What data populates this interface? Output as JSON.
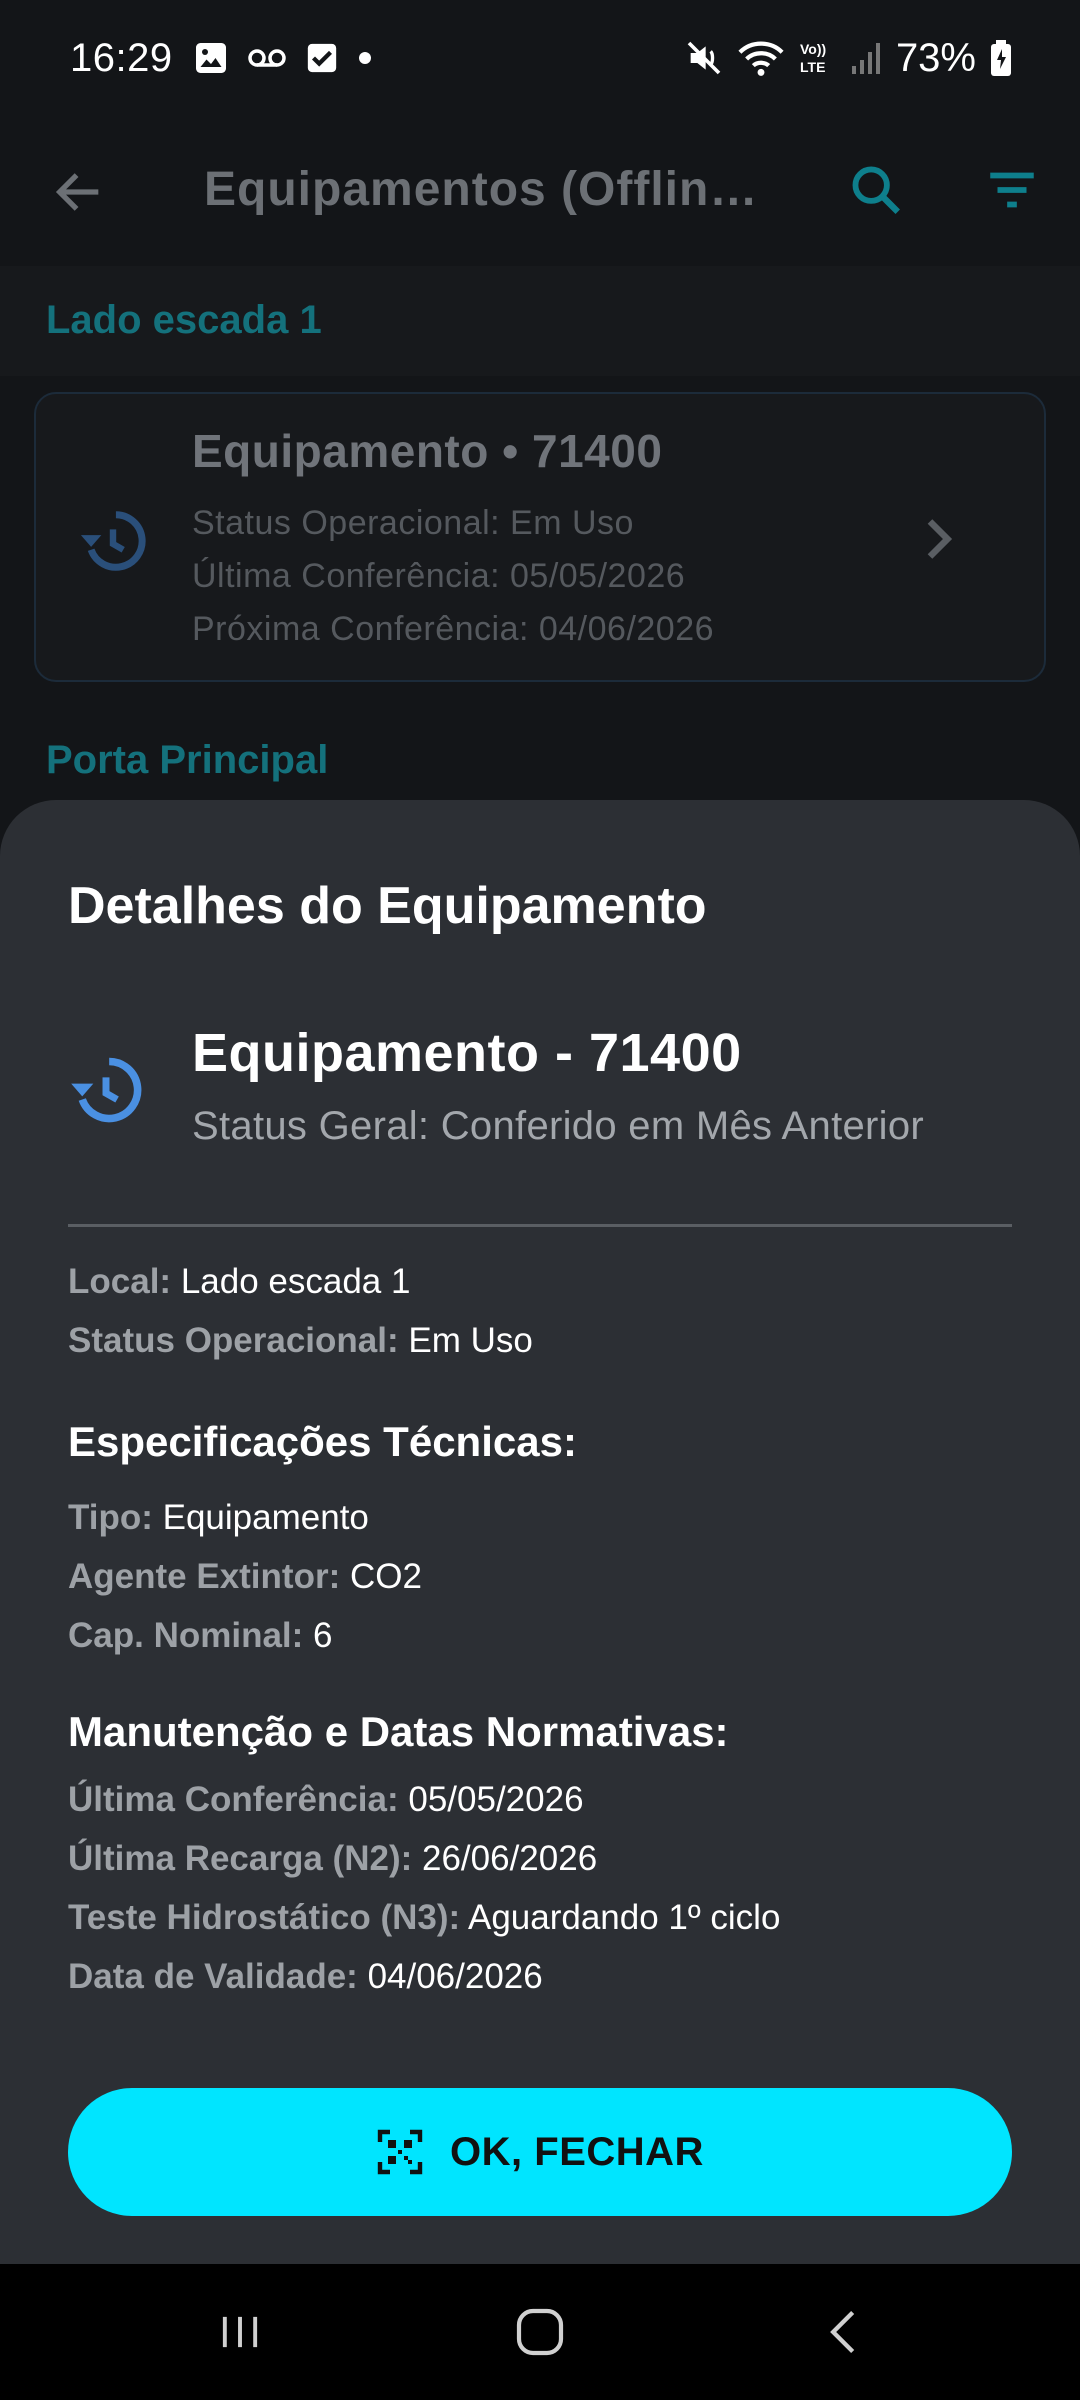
{
  "status_bar": {
    "time": "16:29",
    "battery": "73%",
    "left_icons": [
      "image-icon",
      "voicemail-icon",
      "check-box-icon",
      "dot-icon"
    ],
    "right_icons": [
      "mute-icon",
      "wifi-icon",
      "volte-icon",
      "signal-icon",
      "battery-icon"
    ]
  },
  "app_bar": {
    "title": "Equipamentos (Offlin…",
    "accent": "#00bcd4"
  },
  "list": {
    "section1": "Lado escada 1",
    "card": {
      "title": "Equipamento • 71400",
      "line1": "Status Operacional: Em Uso",
      "line2": "Última Conferência: 05/05/2026",
      "line3": "Próxima Conferência: 04/06/2026"
    },
    "section2": "Porta Principal"
  },
  "sheet": {
    "title": "Detalhes do Equipamento",
    "equipment_title": "Equipamento - 71400",
    "equipment_status": "Status Geral: Conferido em Mês Anterior",
    "local_key": "Local:",
    "local_val": "Lado escada 1",
    "op_key": "Status Operacional:",
    "op_val": "Em Uso",
    "spec_heading": "Especificações Técnicas:",
    "tipo_key": "Tipo:",
    "tipo_val": "Equipamento",
    "agente_key": "Agente Extintor:",
    "agente_val": "CO2",
    "cap_key": "Cap. Nominal:",
    "cap_val": "6",
    "maint_heading": "Manutenção e Datas Normativas:",
    "ult_conf_key": "Última Conferência:",
    "ult_conf_val": "05/05/2026",
    "ult_rec_key": "Última Recarga (N2):",
    "ult_rec_val": "26/06/2026",
    "teste_key": "Teste Hidrostático (N3):",
    "teste_val": "Aguardando 1º ciclo",
    "validade_key": "Data de Validade:",
    "validade_val": "04/06/2026",
    "ok_button": "OK, FECHAR",
    "button_color": "#00e5ff",
    "icon_color": "#4a90e2"
  }
}
